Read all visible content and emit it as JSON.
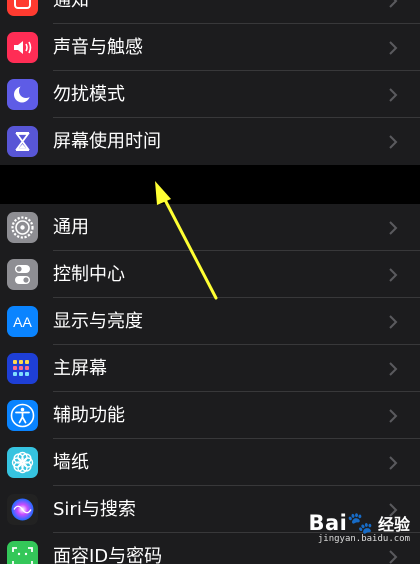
{
  "groups": [
    {
      "items": [
        {
          "label": "通知",
          "icon": "notifications-icon",
          "color": "#ff3b30"
        },
        {
          "label": "声音与触感",
          "icon": "speaker-icon",
          "color": "#ff2d55"
        },
        {
          "label": "勿扰模式",
          "icon": "moon-icon",
          "color": "#5e5ce6"
        },
        {
          "label": "屏幕使用时间",
          "icon": "hourglass-icon",
          "color": "#5856d6"
        }
      ]
    },
    {
      "items": [
        {
          "label": "通用",
          "icon": "gear-icon",
          "color": "#8e8e93"
        },
        {
          "label": "控制中心",
          "icon": "toggles-icon",
          "color": "#8e8e93"
        },
        {
          "label": "显示与亮度",
          "icon": "text-size-icon",
          "color": "#0a84ff"
        },
        {
          "label": "主屏幕",
          "icon": "home-grid-icon",
          "color": "#1e3fd6"
        },
        {
          "label": "辅助功能",
          "icon": "accessibility-icon",
          "color": "#0a84ff"
        },
        {
          "label": "墙纸",
          "icon": "flower-icon",
          "color": "#36c3e0"
        },
        {
          "label": "Siri与搜索",
          "icon": "siri-icon",
          "color": "#222222"
        },
        {
          "label": "面容ID与密码",
          "icon": "face-id-icon",
          "color": "#34c759"
        }
      ]
    }
  ],
  "icon_text": {
    "display": "AA"
  },
  "annotation": {
    "color": "#ffff33"
  },
  "watermark": {
    "logo_a": "Bai",
    "logo_paw": "🐾",
    "logo_b": "经验",
    "url": "jingyan.baidu.com"
  }
}
